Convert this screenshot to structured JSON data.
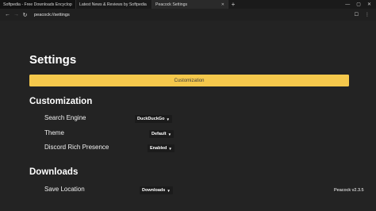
{
  "tabs": [
    {
      "label": "Softpedia - Free Downloads Encyclopedia"
    },
    {
      "label": "Latest News & Reviews by Softpedia"
    },
    {
      "label": "Peacock Settings"
    }
  ],
  "new_tab_label": "+",
  "window_controls": {
    "minimize": "—",
    "maximize": "▢",
    "close": "✕"
  },
  "nav": {
    "back": "←",
    "forward": "→",
    "reload": "↻",
    "url": "peacock://settings",
    "bookmark": "☐",
    "menu": "⋮"
  },
  "page": {
    "title": "Settings",
    "banner": "Customization",
    "sections": [
      {
        "title": "Customization",
        "rows": [
          {
            "label": "Search Engine",
            "value": "DuckDuckGo"
          },
          {
            "label": "Theme",
            "value": "Default"
          },
          {
            "label": "Discord Rich Presence",
            "value": "Enabled"
          }
        ]
      },
      {
        "title": "Downloads",
        "rows": [
          {
            "label": "Save Location",
            "value": "Downloads"
          }
        ]
      }
    ],
    "version": "Peacock v2.3.5"
  },
  "colors": {
    "accent": "#f5c84c",
    "background": "#232323"
  }
}
